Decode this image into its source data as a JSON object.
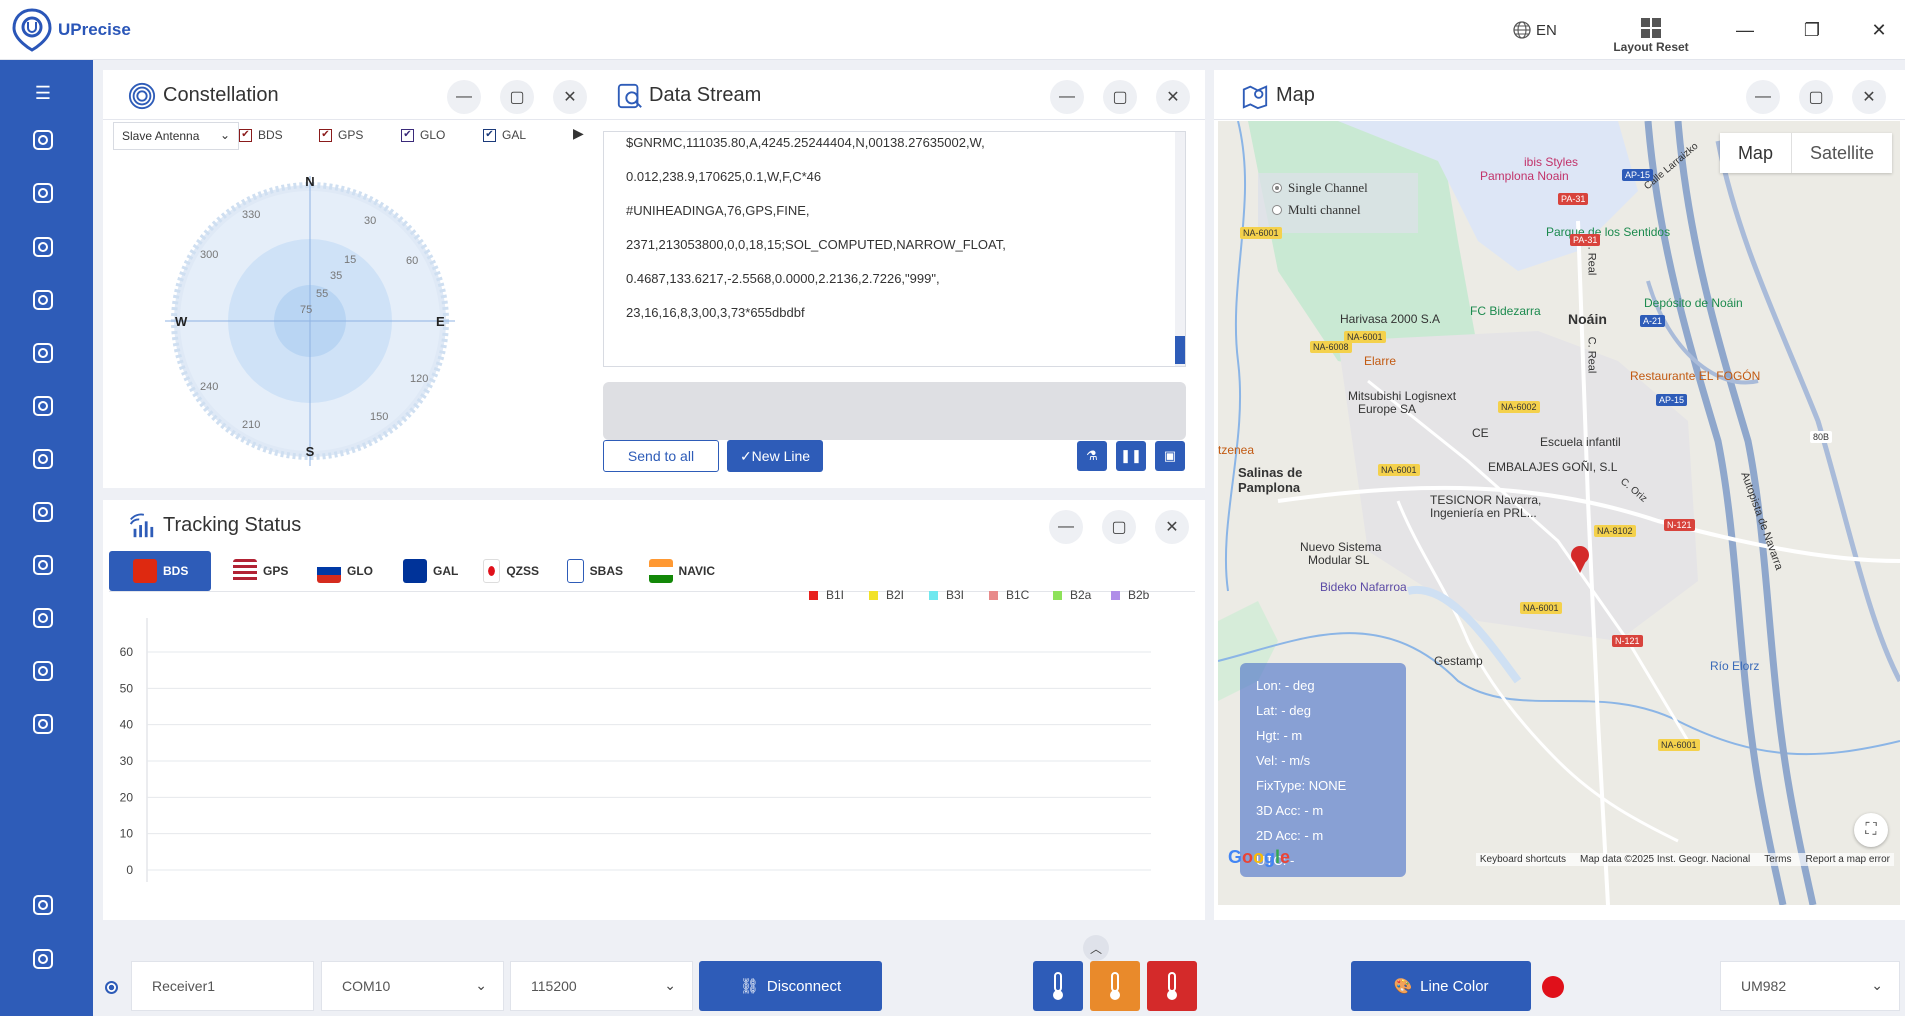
{
  "app": {
    "name": "UPrecise",
    "language": "EN",
    "layout_reset_label": "Layout Reset",
    "minimize_icon": "—",
    "restore_icon": "❐",
    "close_icon": "✕"
  },
  "colors": {
    "accent": "#2e5cb8",
    "sidebar": "#2e5cb8",
    "warm": "#e98a2b",
    "hot": "#d42a2a",
    "status_red": "#e0101a"
  },
  "sidebar": {
    "menu_icon": "☰",
    "items": [
      {
        "name": "device-icon"
      },
      {
        "name": "datastream-icon"
      },
      {
        "name": "constellation-icon"
      },
      {
        "name": "tracking-icon"
      },
      {
        "name": "map-icon"
      },
      {
        "name": "log-icon"
      },
      {
        "name": "config-icon"
      },
      {
        "name": "satellite-icon"
      },
      {
        "name": "settings-icon"
      },
      {
        "name": "report-icon"
      },
      {
        "name": "position-icon"
      },
      {
        "name": "vehicle-icon"
      },
      {
        "name": "security-icon"
      },
      {
        "name": "upgrade-icon"
      }
    ]
  },
  "constellation": {
    "title": "Constellation",
    "antenna": "Slave Antenna",
    "systems": [
      {
        "label": "BDS",
        "color": "#8a1b1b"
      },
      {
        "label": "GPS",
        "color": "#8a1b1b"
      },
      {
        "label": "GLO",
        "color": "#3a2a7a"
      },
      {
        "label": "GAL",
        "color": "#1b3a7a"
      }
    ],
    "more_icon": "▶",
    "compass": {
      "n": "N",
      "e": "E",
      "s": "S",
      "w": "W"
    },
    "azimuth_labels": [
      "30",
      "60",
      "120",
      "150",
      "210",
      "240",
      "300",
      "330"
    ],
    "elevation_labels": [
      "15",
      "35",
      "55",
      "75"
    ]
  },
  "datastream": {
    "title": "Data Stream",
    "lines": [
      "$GNRMC,111035.80,A,4245.25244404,N,00138.27635002,W,",
      "0.012,238.9,170625,0.1,W,F,C*46",
      "#UNIHEADINGA,76,GPS,FINE,",
      "2371,213053800,0,0,18,15;SOL_COMPUTED,NARROW_FLOAT,",
      "0.4687,133.6217,-2.5568,0.0000,2.2136,2.7226,\"999\",",
      "23,16,16,8,3,00,3,73*655dbdbf"
    ],
    "send_to_all": "Send to all",
    "new_line": "✓New Line",
    "clear_icon": "⚗",
    "pause_icon": "❚❚",
    "save_icon": "▣"
  },
  "tracking": {
    "title": "Tracking Status",
    "tabs": [
      {
        "label": "BDS"
      },
      {
        "label": "GPS"
      },
      {
        "label": "GLO"
      },
      {
        "label": "GAL"
      },
      {
        "label": "QZSS"
      },
      {
        "label": "SBAS"
      },
      {
        "label": "NAVIC"
      }
    ],
    "legend": [
      {
        "label": "B1I",
        "color": "#e8201e"
      },
      {
        "label": "B2I",
        "color": "#f2e227"
      },
      {
        "label": "B3I",
        "color": "#6fe8ef"
      },
      {
        "label": "B1C",
        "color": "#e88a8a"
      },
      {
        "label": "B2a",
        "color": "#8ee25a"
      },
      {
        "label": "B2b",
        "color": "#b08ee8"
      }
    ]
  },
  "chart_data": {
    "type": "bar",
    "categories": [],
    "series": [],
    "ylim": [
      0,
      60
    ],
    "yticks": [
      "60",
      "50",
      "40",
      "30",
      "20",
      "10",
      "0"
    ],
    "grid": true
  },
  "map": {
    "title": "Map",
    "map_tab": "Map",
    "satellite_tab": "Satellite",
    "single_channel": "Single Channel",
    "multi_channel": "Multi channel",
    "info": {
      "lon": "Lon: - deg",
      "lat": "Lat: - deg",
      "hgt": "Hgt: - m",
      "vel": "Vel: - m/s",
      "fixtype": "FixType: NONE",
      "acc3d": "3D Acc:  - m",
      "acc2d": "2D Acc:  - m",
      "utc": "UTC: -"
    },
    "places": {
      "ibis": "ibis Styles",
      "ibis2": "Pamplona Noain",
      "parque": "Parque de los Sentidos",
      "deposito": "Depósito de Noáin",
      "fc": "FC Bidezarra",
      "harivasa": "Harivasa 2000 S.A",
      "noain": "Noáin",
      "elarre": "Elarre",
      "mitsubishi": "Mitsubishi Logisnext",
      "mitsubishi2": "Europe SA",
      "restaurante": "Restaurante EL FOGÓN",
      "escuela": "Escuela infantil",
      "embalajes": "EMBALAJES GOÑI, S.L",
      "tesicnor": "TESICNOR Navarra,",
      "tesicnor2": "Ingeniería en PRL...",
      "salinas": "Salinas de",
      "salinas2": "Pamplona",
      "nuevo": "Nuevo Sistema",
      "nuevo2": "Modular SL",
      "bideko": "Bideko Nafarroa",
      "gestamp": "Gestamp",
      "zenea": "tzenea",
      "creal": "C. Real",
      "creal2": "C. Real",
      "rio": "Río Elorz",
      "autopista": "Autopista de Navarra",
      "ce": "CE",
      "larraizko": "Calle Larraizko",
      "coriz": "C. Oriz"
    },
    "roads": {
      "na6001a": "NA-6001",
      "na6001b": "NA-6001",
      "na6001c": "NA-6001",
      "na6001d": "NA-6001",
      "na6001e": "NA-6001",
      "na6008": "NA-6008",
      "na6002": "NA-6002",
      "na8102": "NA-8102",
      "pa31a": "PA-31",
      "pa31b": "PA-31",
      "ap15a": "AP-15",
      "ap15b": "AP-15",
      "a21": "A-21",
      "n121a": "N-121",
      "n121b": "N-121",
      "b08": "80B"
    },
    "google": "Google",
    "keyboard": "Keyboard shortcuts",
    "mapdata": "Map data ©2025 Inst. Geogr. Nacional",
    "terms": "Terms",
    "report": "Report a map error"
  },
  "bottom": {
    "collapse_icon": "︿",
    "receiver": "Receiver1",
    "port": "COM10",
    "baud": "115200",
    "disconnect": "Disconnect",
    "line_color": "Line Color",
    "model": "UM982",
    "chevron": "⌄"
  }
}
